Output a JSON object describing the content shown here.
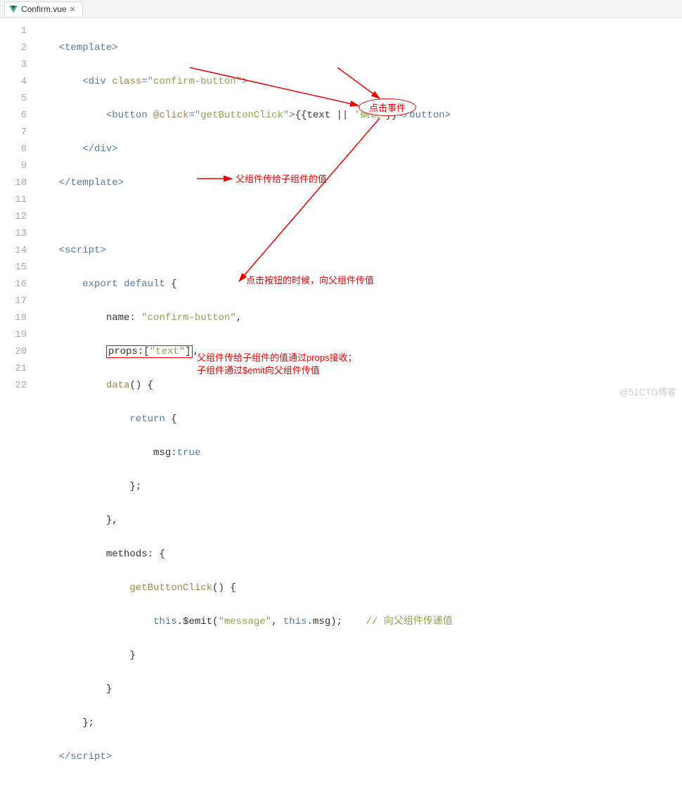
{
  "tab": {
    "filename": "Confirm.vue"
  },
  "gutter": {
    "start": 1,
    "end": 22
  },
  "code": {
    "l1": {
      "a": "<",
      "b": "template",
      "c": ">"
    },
    "l2": {
      "a": "<",
      "b": "div ",
      "c": "class",
      "d": "=",
      "e": "\"confirm-button\"",
      "f": ">"
    },
    "l3": {
      "a": "<",
      "b": "button ",
      "c": "@click",
      "d": "=",
      "e": "\"getButtonClick\"",
      "f": ">",
      "g": "{{text || ",
      "h": "'确认'",
      "i": "}}",
      "j": "</",
      "k": "button",
      "l": ">"
    },
    "l4": {
      "a": "</",
      "b": "div",
      "c": ">"
    },
    "l5": {
      "a": "</",
      "b": "template",
      "c": ">"
    },
    "l7": {
      "a": "<",
      "b": "script",
      "c": ">"
    },
    "l8": {
      "a": "export default ",
      "b": "{"
    },
    "l9": {
      "a": "name: ",
      "b": "\"confirm-button\"",
      "c": ","
    },
    "l10": {
      "a": "props:[",
      "b": "\"text\"",
      "c": "]",
      "d": ","
    },
    "l11": {
      "a": "data",
      "b": "() {"
    },
    "l12": {
      "a": "return ",
      "b": "{"
    },
    "l13": {
      "a": "msg:",
      "b": "true"
    },
    "l14": {
      "a": "};"
    },
    "l15": {
      "a": "},"
    },
    "l16": {
      "a": "methods: {"
    },
    "l17": {
      "a": "getButtonClick",
      "b": "() {"
    },
    "l18": {
      "a": "this",
      "b": ".$emit(",
      "c": "\"message\"",
      "d": ", ",
      "e": "this",
      "f": ".msg);",
      "g": "// 向父组件传递值"
    },
    "l19": {
      "a": "}"
    },
    "l20": {
      "a": "}"
    },
    "l21": {
      "a": "};"
    },
    "l22": {
      "a": "</",
      "b": "script",
      "c": ">"
    }
  },
  "annotations": {
    "oval1": "点击事件",
    "a1": "父组件传给子组件的值",
    "a2": "点击按钮的时候，向父组件传值",
    "a3_line1": "父组件传给子组件的值通过props接收；",
    "a3_line2": "子组件通过$emit向父组件传值"
  },
  "watermark": "@51CTO博客"
}
